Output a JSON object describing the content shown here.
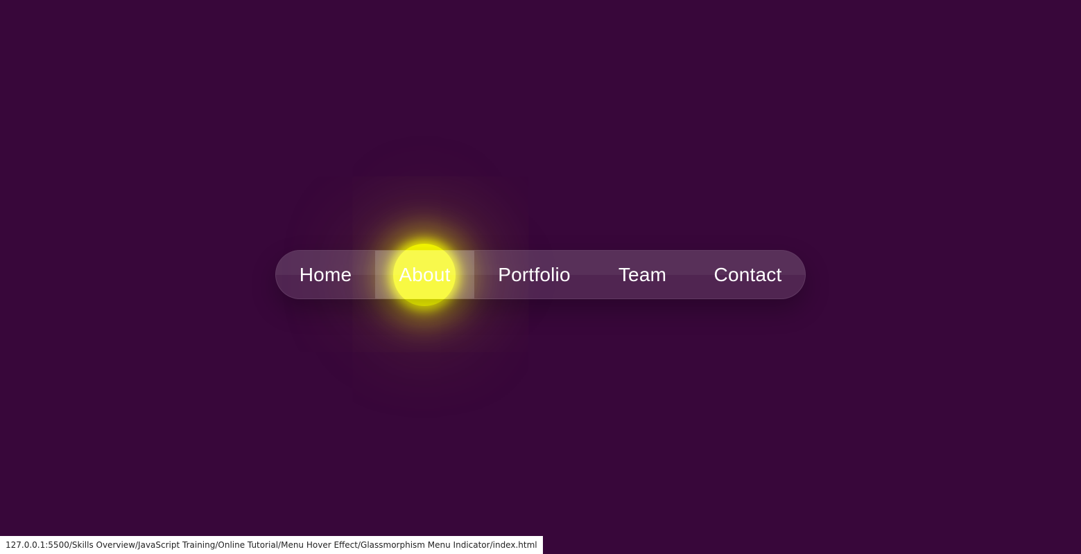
{
  "page": {
    "background_color": "#38073a",
    "indicator_color": "#f6f800"
  },
  "menu": {
    "active_item": "About",
    "items": [
      {
        "label": "Home"
      },
      {
        "label": "About"
      },
      {
        "label": "Portfolio"
      },
      {
        "label": "Team"
      },
      {
        "label": "Contact"
      }
    ]
  },
  "status_bar": {
    "url": "127.0.0.1:5500/Skills Overview/JavaScript Training/Online Tutorial/Menu Hover Effect/Glassmorphism Menu Indicator/index.html"
  }
}
